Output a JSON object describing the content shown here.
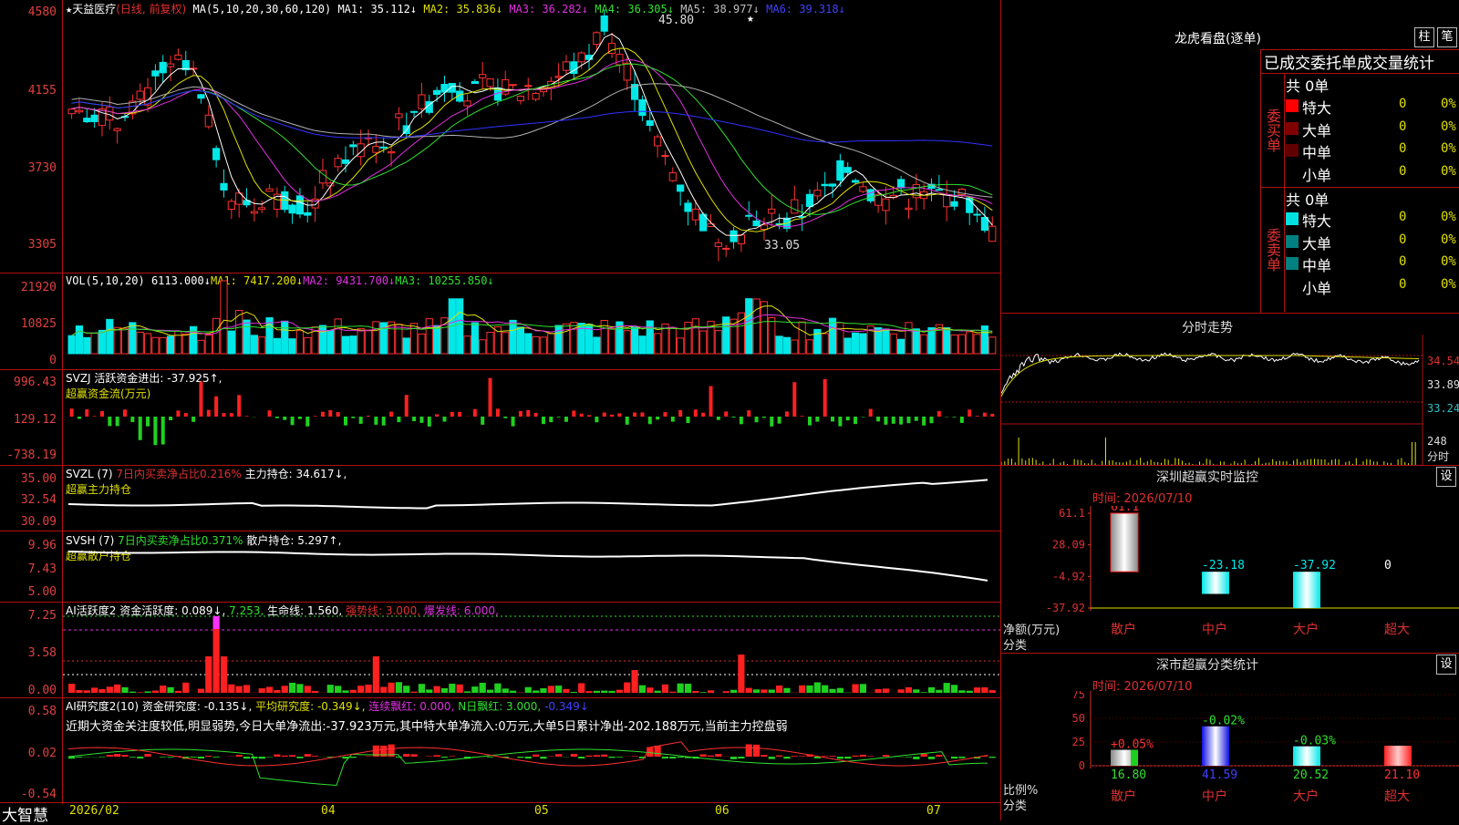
{
  "kline_panel": {
    "yticks": [
      "4580",
      "4155",
      "3730",
      "3305"
    ],
    "title_stock": "天益医疗",
    "title_mode": "(日线, 前复权)",
    "ma_label": "MA(5,10,20,30,60,120)",
    "ma_values": [
      {
        "label": "MA1: 35.112↓",
        "color": "#ffffff"
      },
      {
        "label": "MA2: 35.836↓",
        "color": "#e0e000"
      },
      {
        "label": "MA3: 36.282↓",
        "color": "#e030e0"
      },
      {
        "label": "MA4: 36.305↓",
        "color": "#30e030"
      },
      {
        "label": "MA5: 38.977↓",
        "color": "#c0c0c0"
      },
      {
        "label": "MA6: 39.318↓",
        "color": "#4040ff"
      }
    ],
    "high_label": "45.80",
    "low_label": "33.05"
  },
  "vol_panel": {
    "yticks": [
      "21920",
      "10825",
      "0"
    ],
    "label": "VOL(5,10,20)",
    "val": "6113.000↓",
    "ma1": "MA1: 7417.200↓",
    "ma2": "MA2: 9431.700↓",
    "ma3": "MA3: 10255.850↓"
  },
  "svzj_panel": {
    "yticks": [
      "996.43",
      "129.12",
      "-738.19"
    ],
    "label": "SVZJ",
    "line1": "活跃资金进出: -37.925↑,",
    "line2": "超赢资金流(万元)"
  },
  "svzl_panel": {
    "yticks": [
      "35.00",
      "32.54",
      "30.09"
    ],
    "label": "SVZL (7)",
    "red": "7日内买卖净占比0.216%",
    "white": "主力持仓: 34.617↓,",
    "line2": "超赢主力持仓"
  },
  "svsh_panel": {
    "yticks": [
      "9.96",
      "7.43",
      "5.00"
    ],
    "label": "SVSH (7)",
    "green": "7日内买卖净占比0.371%",
    "white": "散户持仓: 5.297↑,",
    "line2": "超赢散户持仓"
  },
  "ai_panel": {
    "yticks": [
      "7.25",
      "3.58",
      "0.00"
    ],
    "label": "AI活跃度2",
    "a": "资金活跃度: 0.089↓,",
    "b": "7.253,",
    "c": "生命线: 1.560,",
    "d": "强势线: 3.000,",
    "e": "爆发线: 6.000,"
  },
  "research_panel": {
    "yticks": [
      "0.58",
      "0.02",
      "-0.54"
    ],
    "label": "AI研究度2(10)",
    "a": "资金研究度: -0.135↓,",
    "b": "平均研究度: -0.349↓,",
    "c": "连续飘红: 0.000,",
    "d": "N日飘红: 3.000,",
    "e": "-0.349↓",
    "note": "近期大资金关注度较低,明显弱势,今日大单净流出:-37.923万元,其中特大单净流入:0万元,大单5日累计净出-202.188万元,当前主力控盘弱"
  },
  "xaxis": {
    "brand": "大智慧",
    "labels": [
      "2026/02",
      "04",
      "05",
      "06",
      "07"
    ]
  },
  "right": {
    "dragon_title": "龙虎看盘(逐单)",
    "btn_zhu": "柱",
    "btn_bi": "笔",
    "order_title": "已成交委托单成交量统计",
    "buy_group": "委买单",
    "sell_group": "委卖单",
    "buy_total": "共 0单",
    "sell_total": "共 0单",
    "buy_rows": [
      {
        "name": "特大",
        "n": "0",
        "p": "0%",
        "color": "#ff0000"
      },
      {
        "name": "大单",
        "n": "0",
        "p": "0%",
        "color": "#800000"
      },
      {
        "name": "中单",
        "n": "0",
        "p": "0%",
        "color": "#600000"
      },
      {
        "name": "小单",
        "n": "0",
        "p": "0%",
        "color": "#000000"
      }
    ],
    "sell_rows": [
      {
        "name": "特大",
        "n": "0",
        "p": "0%",
        "color": "#00e0e0"
      },
      {
        "name": "大单",
        "n": "0",
        "p": "0%",
        "color": "#008080"
      },
      {
        "name": "中单",
        "n": "0",
        "p": "0%",
        "color": "#008080"
      },
      {
        "name": "小单",
        "n": "0",
        "p": "0%",
        "color": "#000000"
      }
    ],
    "intraday_title": "分时走势",
    "intraday_prices": [
      "34.54",
      "33.89",
      "33.24"
    ],
    "intraday_vol": "248",
    "intraday_vol_unit": "分时",
    "monitor_title": "深圳超赢实时监控",
    "monitor_btn": "设",
    "monitor_time": "时间: 2026/07/10",
    "monitor_yticks": [
      "61.1",
      "28.09",
      "-4.92",
      "-37.92"
    ],
    "monitor_unit": "净额(万元)",
    "monitor_cat_label": "分类",
    "monitor_cats": [
      "散户",
      "中户",
      "大户",
      "超大"
    ],
    "monitor_vals": [
      "61.1",
      "-23.18",
      "-37.92",
      "0"
    ],
    "stats_title": "深市超赢分类统计",
    "stats_btn": "设",
    "stats_time": "时间: 2026/07/10",
    "stats_yticks": [
      "75",
      "50",
      "25",
      "0"
    ],
    "stats_unit": "比例%",
    "stats_cat_label": "分类",
    "stats_cats": [
      "散户",
      "中户",
      "大户",
      "超大"
    ],
    "stats_vals": [
      "16.80",
      "41.59",
      "20.52",
      "21.10"
    ],
    "stats_changes": [
      "+0.05%",
      "-0.02%",
      "-0.03%",
      ""
    ]
  },
  "chart_data": {
    "type": "bar",
    "title": "深圳超赢实时监控",
    "categories": [
      "散户",
      "中户",
      "大户",
      "超大"
    ],
    "values": [
      61.1,
      -23.18,
      -37.92,
      0
    ],
    "ylabel": "净额(万元)",
    "ylim": [
      -37.92,
      61.1
    ]
  },
  "stats_chart": {
    "type": "bar",
    "title": "深市超赢分类统计",
    "categories": [
      "散户",
      "中户",
      "大户",
      "超大"
    ],
    "values": [
      16.8,
      41.59,
      20.52,
      21.1
    ],
    "ylabel": "比例%",
    "ylim": [
      0,
      75
    ]
  }
}
